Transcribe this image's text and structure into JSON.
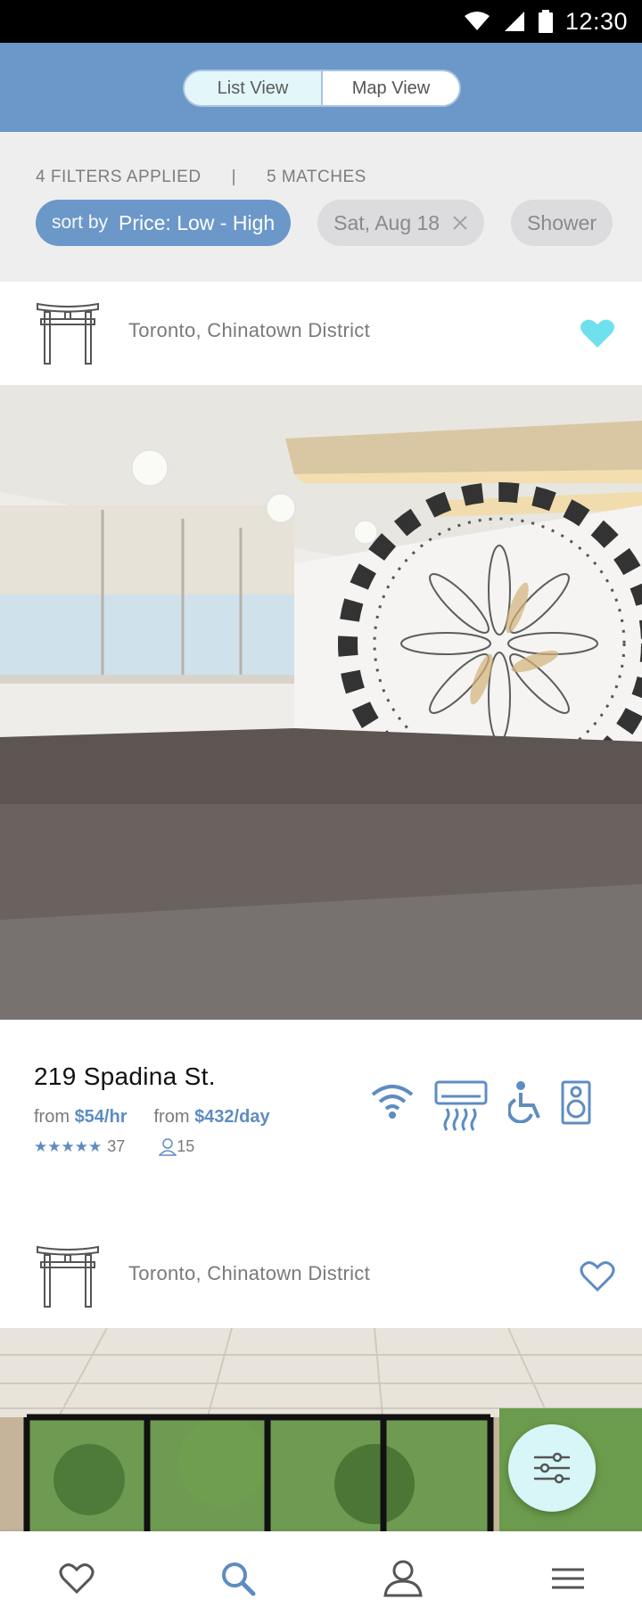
{
  "status_bar": {
    "time": "12:30"
  },
  "view_toggle": {
    "list_label": "List View",
    "map_label": "Map View",
    "active": "List View"
  },
  "filters": {
    "applied_text": "4 FILTERS APPLIED",
    "separator": "|",
    "matches_text": "5 MATCHES",
    "sort_prefix": "sort by",
    "sort_value": "Price: Low - High",
    "chips": [
      {
        "label": "Sat, Aug 18",
        "removable": true
      },
      {
        "label": "Shower",
        "removable": false
      }
    ]
  },
  "listings": [
    {
      "location": "Toronto, Chinatown District",
      "favorited": true,
      "address": "219 Spadina St.",
      "from_label": "from",
      "hourly_price": "$54/hr",
      "daily_price": "$432/day",
      "stars": "★★★★★",
      "rating_count": "37",
      "capacity": "15",
      "amenities": [
        "wifi-icon",
        "air-conditioning-icon",
        "accessible-icon",
        "speaker-icon"
      ]
    },
    {
      "location": "Toronto, Chinatown District",
      "favorited": false
    }
  ],
  "colors": {
    "primary": "#6b98c9",
    "accent": "#5e8cc2",
    "favorite_active": "#6fe0ee",
    "fab_bg": "#d8f6f8",
    "filter_bg": "#efeeef"
  },
  "bottom_nav": [
    "heart-icon",
    "search-icon",
    "profile-icon",
    "menu-icon"
  ],
  "bottom_nav_active": "search-icon"
}
